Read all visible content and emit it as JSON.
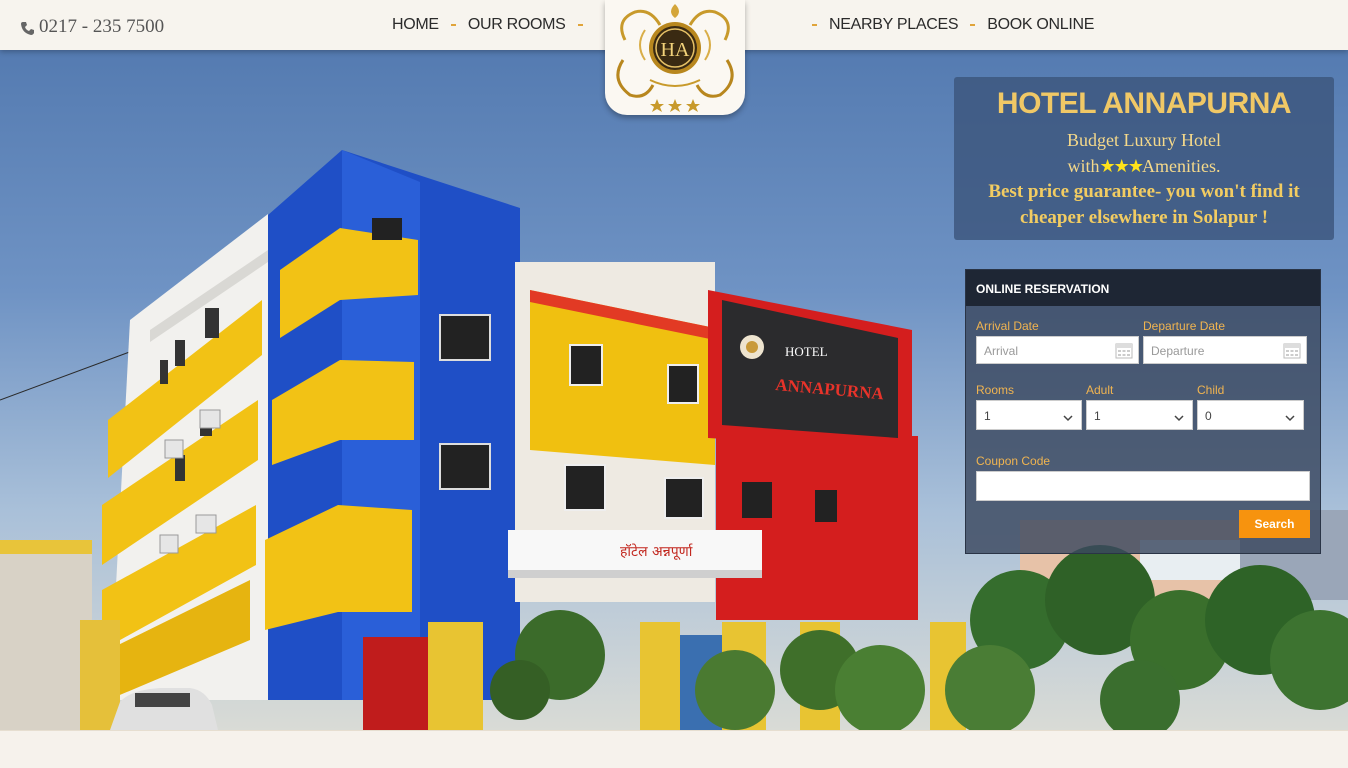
{
  "header": {
    "phone": "0217 - 235 7500",
    "phone_icon": "phone-icon",
    "nav_left": [
      "HOME",
      "OUR ROOMS"
    ],
    "nav_right": [
      "NEARBY PLACES",
      "BOOK ONLINE"
    ],
    "logo_initials": "HA",
    "logo_stars": 3
  },
  "info": {
    "title": "HOTEL ANNAPURNA",
    "line1": "Budget Luxury Hotel",
    "line2_prefix": "with",
    "line2_stars": "★★★",
    "line2_suffix": "Amenities.",
    "line3": "Best price guarantee- you won't find it",
    "line4": "cheaper elsewhere in Solapur !"
  },
  "reservation": {
    "heading": "ONLINE RESERVATION",
    "arrival_label": "Arrival Date",
    "arrival_placeholder": "Arrival",
    "departure_label": "Departure Date",
    "departure_placeholder": "Departure",
    "rooms_label": "Rooms",
    "rooms_value": "1",
    "adult_label": "Adult",
    "adult_value": "1",
    "child_label": "Child",
    "child_value": "0",
    "coupon_label": "Coupon Code",
    "coupon_value": "",
    "search_label": "Search"
  },
  "building_sign": {
    "line1": "HOTEL",
    "line2": "ANNAPURNA",
    "entrance": "हॉटेल अन्नपूर्णा"
  },
  "colors": {
    "accent_orange": "#f7930e",
    "gold": "#f0c866",
    "building_yellow": "#f2c215",
    "building_blue": "#1f4fc6",
    "building_red": "#d41e1e"
  }
}
